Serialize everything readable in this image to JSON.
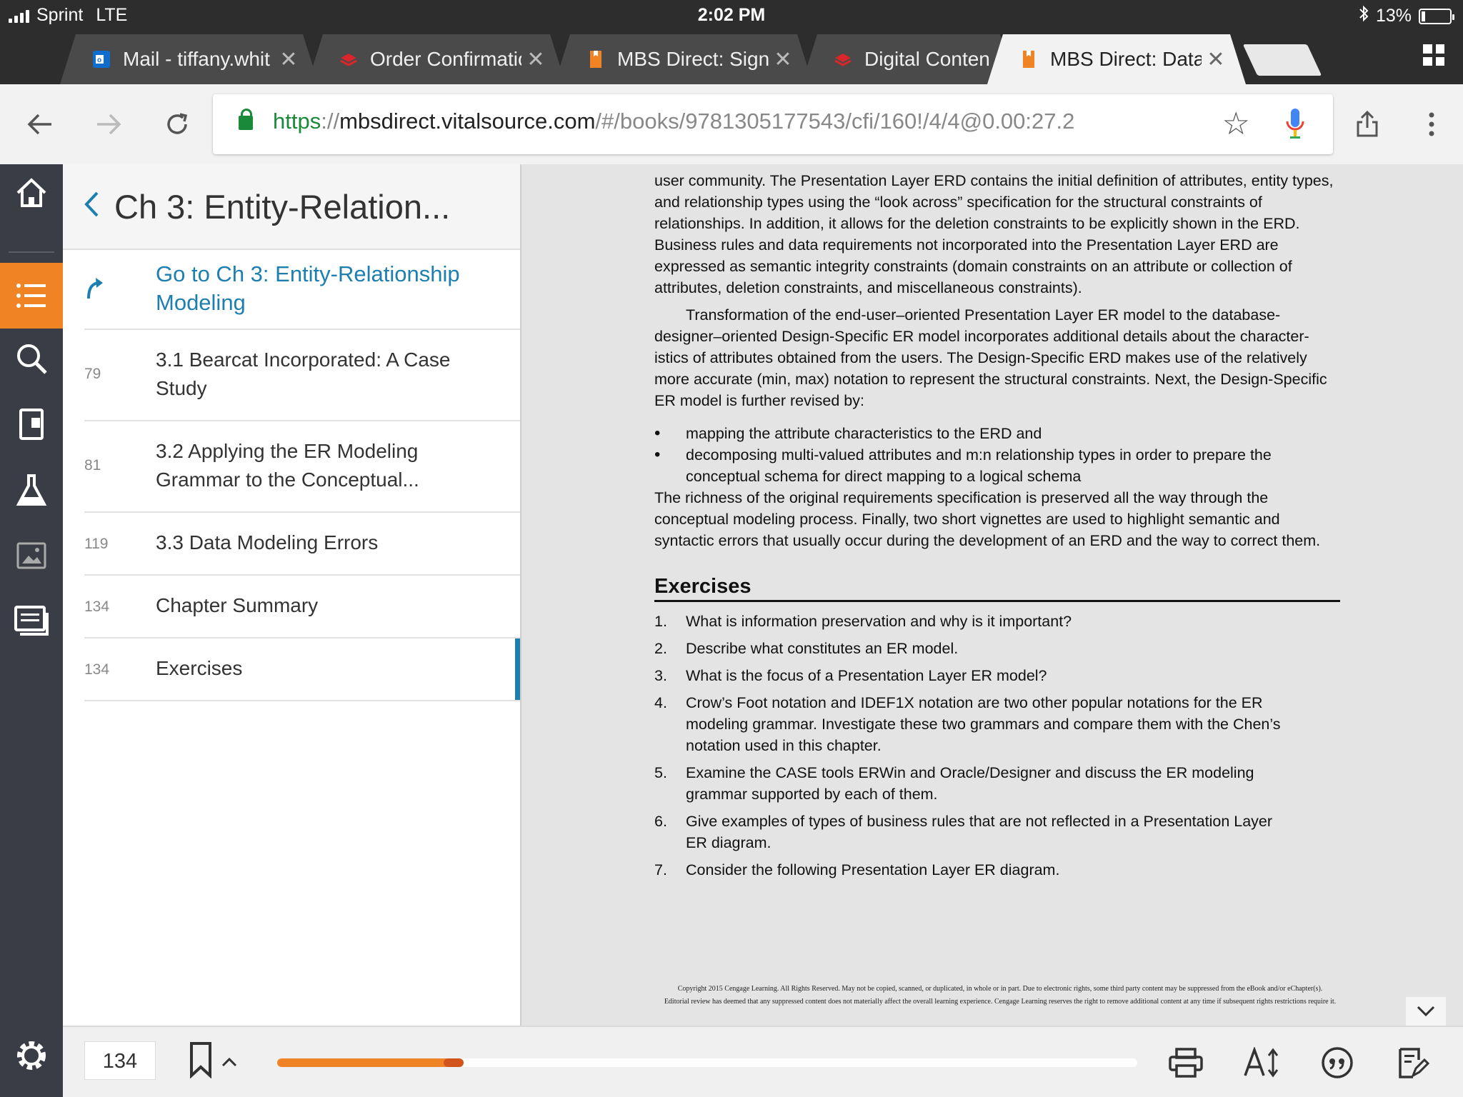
{
  "status_bar": {
    "carrier": "Sprint",
    "network": "LTE",
    "time": "2:02 PM",
    "bluetooth": "bluetooth-icon",
    "battery_percent": "13%",
    "battery_level": 0.13
  },
  "tabs": [
    {
      "title": "Mail - tiffany.whit",
      "favicon": "outlook-icon",
      "active": false
    },
    {
      "title": "Order Confirmatio",
      "favicon": "book-stack-icon",
      "active": false
    },
    {
      "title": "MBS Direct: Sign I",
      "favicon": "mbs-bookmark-icon",
      "active": false
    },
    {
      "title": "Digital Conten",
      "favicon": "book-stack-icon",
      "active": false
    },
    {
      "title": "MBS Direct: Data",
      "favicon": "mbs-bookmark-icon",
      "active": true
    }
  ],
  "address_bar": {
    "scheme": "https",
    "separator": "://",
    "host": "mbsdirect.vitalsource.com",
    "path": "/#/books/9781305177543/cfi/160!/4/4@0.00:27.2"
  },
  "toc": {
    "back_title": "Ch 3: Entity-Relation...",
    "goto_label": "Go to Ch 3: Entity-Relationship Modeling",
    "items": [
      {
        "page": "79",
        "label": "3.1 Bearcat Incorporated: A Case Study"
      },
      {
        "page": "81",
        "label": "3.2 Applying the ER Modeling Grammar to the Conceptual..."
      },
      {
        "page": "119",
        "label": "3.3 Data Modeling Errors"
      },
      {
        "page": "134",
        "label": "Chapter Summary"
      },
      {
        "page": "134",
        "label": "Exercises",
        "current": true
      }
    ]
  },
  "document": {
    "para1": "user community. The Presentation Layer ERD contains the initial definition of attributes, entity types, and relationship types using the “look across” specification for the structural constraints of relationships. In addition, it allows for the deletion constraints to be explicitly shown in the ERD. Business rules and data requirements not incorporated into the Presentation Layer ERD are expressed as semantic integrity constraints (domain constraints on an attribute or collection of attributes, deletion constraints, and miscellaneous constraints).",
    "para2": "Transformation of the end-user–oriented Presentation Layer ER model to the database-designer–oriented Design-Specific ER model incorporates additional details about the character-istics of attributes obtained from the users. The Design-Specific ERD makes use of the relatively more accurate (min, max) notation to represent the structural constraints. Next, the Design-Specific ER model is further revised by:",
    "bullets": [
      "mapping the attribute characteristics to the ERD and",
      "decomposing multi-valued attributes and m:n relationship types in order to prepare the conceptual schema for direct mapping to a logical schema"
    ],
    "para3": "The richness of the original requirements specification is preserved all the way through the conceptual modeling process. Finally, two short vignettes are used to highlight semantic and syntactic errors that usually occur during the development of an ERD and the way to correct them.",
    "exercises_heading": "Exercises",
    "exercises": [
      {
        "num": "1.",
        "text": "What is information preservation and why is it important?"
      },
      {
        "num": "2.",
        "text": "Describe what constitutes an ER model."
      },
      {
        "num": "3.",
        "text": "What is the focus of a Presentation Layer ER model?"
      },
      {
        "num": "4.",
        "text": "Crow’s Foot notation and IDEF1X notation are two other popular notations for the ER modeling grammar. Investigate these two grammars and compare them with the Chen’s notation used in this chapter."
      },
      {
        "num": "5.",
        "text": "Examine the CASE tools ERWin and Oracle/Designer and discuss the ER modeling grammar supported by each of them."
      },
      {
        "num": "6.",
        "text": "Give examples of types of business rules that are not reflected in a Presentation Layer ER diagram."
      },
      {
        "num": "7.",
        "text": "Consider the following Presentation Layer ER diagram."
      }
    ],
    "copyright_line1": "Copyright 2015 Cengage Learning. All Rights Reserved. May not be copied, scanned, or duplicated, in whole or in part. Due to electronic rights, some third party content may be suppressed from the eBook and/or eChapter(s).",
    "copyright_line2": "Editorial review has deemed that any suppressed content does not materially affect the overall learning experience. Cengage Learning reserves the right to remove additional content at any time if subsequent rights restrictions require it."
  },
  "bottom_bar": {
    "page_number": "134",
    "reading_progress": 0.21
  },
  "colors": {
    "accent": "#f08324",
    "link": "#1d7fb0",
    "rail": "#3a3d45"
  }
}
